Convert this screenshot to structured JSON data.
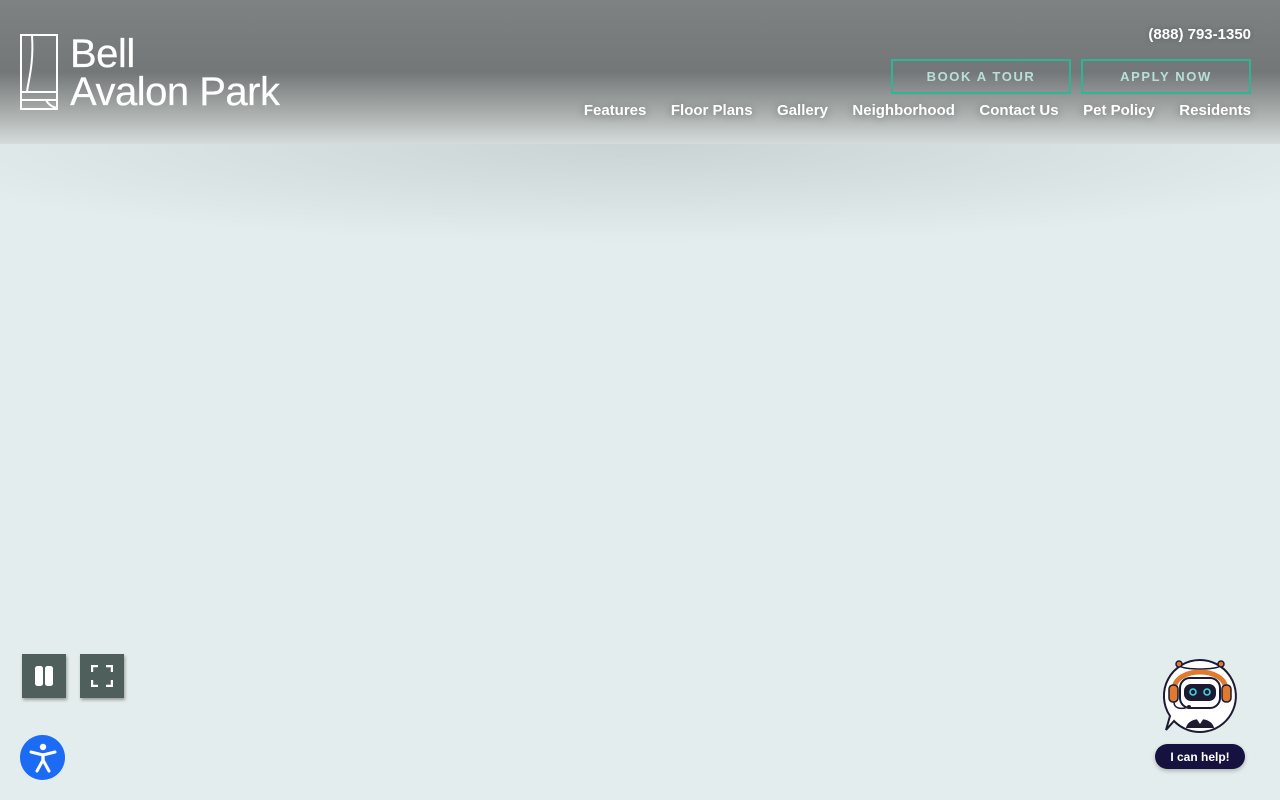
{
  "header": {
    "logo_line1": "Bell",
    "logo_line2": "Avalon Park",
    "phone": "(888) 793-1350",
    "cta": {
      "book_tour": "BOOK A TOUR",
      "apply_now": "APPLY NOW"
    },
    "nav": [
      {
        "label": "Features"
      },
      {
        "label": "Floor Plans"
      },
      {
        "label": "Gallery"
      },
      {
        "label": "Neighborhood"
      },
      {
        "label": "Contact Us"
      },
      {
        "label": "Pet Policy"
      },
      {
        "label": "Residents"
      }
    ]
  },
  "video_controls": {
    "pause_icon": "pause-icon",
    "fullscreen_icon": "fullscreen-icon"
  },
  "accessibility": {
    "icon": "accessibility-person-icon",
    "color": "#1c6bf5"
  },
  "chat": {
    "icon": "robot-assistant-icon",
    "label": "I can help!"
  },
  "colors": {
    "accent": "#2fb496",
    "control_bg": "#4f605c",
    "chat_pill": "#16123f",
    "page_bg": "#e4eded"
  }
}
